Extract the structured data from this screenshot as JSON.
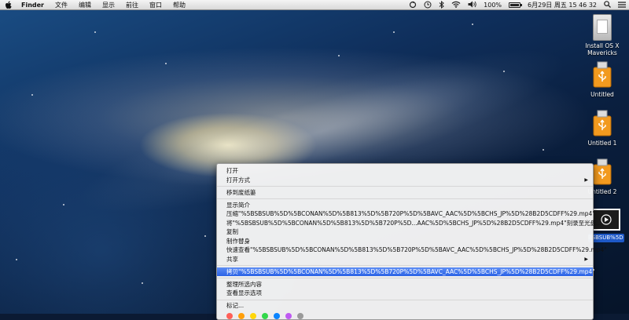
{
  "menubar": {
    "app_name": "Finder",
    "items": [
      "文件",
      "编辑",
      "显示",
      "前往",
      "窗口",
      "帮助"
    ],
    "battery_percent": "100%",
    "battery_level": 1.0,
    "date_time": "6月29日 周五  15 46 32",
    "icons": [
      "apple-icon",
      "sync-icon",
      "clock-icon",
      "bluetooth-icon",
      "wifi-icon",
      "volume-icon",
      "battery-icon",
      "search-icon",
      "list-icon"
    ]
  },
  "desktop_icons": [
    {
      "label": "Install OS X Mavericks",
      "icon": "installer-disk-icon"
    },
    {
      "label": "Untitled",
      "icon": "usb-drive-icon"
    },
    {
      "label": "Untitled 1",
      "icon": "usb-drive-icon"
    },
    {
      "label": "Untitled 2",
      "icon": "usb-drive-icon"
    }
  ],
  "video_file": {
    "label": "%5BSBSUB%5D%5BCONAN%5D%5B813%5D%5B720P%5D%5BAVC_AAC%5D%5BCHS_JP%5D%28B2D5CDFF%29.mp4",
    "label_visible": "BSBSUB%5D O...29.mp4",
    "icon": "video-file-icon"
  },
  "context_menu": {
    "items": [
      {
        "label": "打开",
        "submenu": false
      },
      {
        "label": "打开方式",
        "submenu": true
      },
      {
        "separator": true
      },
      {
        "label": "移到废纸篓",
        "submenu": false
      },
      {
        "separator": true
      },
      {
        "label": "显示简介",
        "submenu": false
      },
      {
        "label": "压缩\"%5BSBSUB%5D%5BCONAN%5D%5B813%5D%5B720P%5D%5BAVC_AAC%5D%5BCHS_JP%5D%28B2D5CDFF%29.mp4\"",
        "submenu": false
      },
      {
        "label": "将\"%5BSBSUB%5D%5BCONAN%5D%5B813%5D%5B720P%5D...AAC%5D%5BCHS_JP%5D%28B2D5CDFF%29.mp4\"刻录至光盘...",
        "submenu": false
      },
      {
        "label": "复制",
        "submenu": false
      },
      {
        "label": "制作替身",
        "submenu": false
      },
      {
        "label": "快速查看\"%5BSBSUB%5D%5BCONAN%5D%5B813%5D%5B720P%5D%5BAVC_AAC%5D%5BCHS_JP%5D%28B2D5CDFF%29.mp4\"",
        "submenu": false
      },
      {
        "label": "共享",
        "submenu": true
      },
      {
        "separator": true
      },
      {
        "label": "拷贝\"%5BSBSUB%5D%5BCONAN%5D%5B813%5D%5B720P%5D%5BAVC_AAC%5D%5BCHS_JP%5D%28B2D5CDFF%29.mp4\"",
        "submenu": false,
        "selected": true
      },
      {
        "separator": true
      },
      {
        "label": "整理所选内容",
        "submenu": false
      },
      {
        "label": "查看显示选项",
        "submenu": false
      },
      {
        "separator": true
      },
      {
        "label": "标记...",
        "submenu": false
      }
    ],
    "submenu_arrow": "▶",
    "tag_colors": [
      "#ff5f57",
      "#ff9f0a",
      "#ffd60a",
      "#32d74b",
      "#0a84ff",
      "#bf5af2",
      "#9a9a9a"
    ]
  }
}
